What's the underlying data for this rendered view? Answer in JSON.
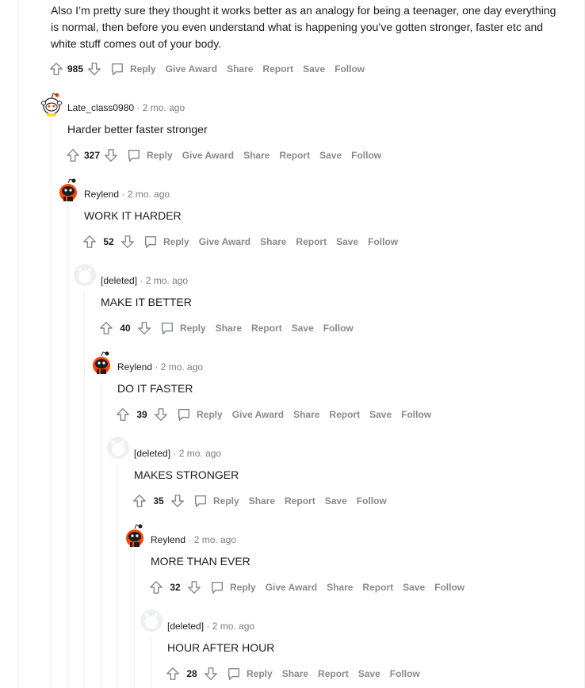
{
  "intro": {
    "text": "Also I’m pretty sure they thought it works better as an analogy for being a teenager, one day everything is normal, then before you even understand what is happening you’ve gotten stronger, faster etc and white stuff comes out of your body.",
    "score": "985",
    "reply": "Reply",
    "award": "Give Award",
    "share": "Share",
    "report": "Report",
    "save": "Save",
    "follow": "Follow"
  },
  "comments": [
    {
      "author": "Late_class0980",
      "time": "· 2 mo. ago",
      "body": "Harder better faster stronger",
      "score": "327",
      "reply": "Reply",
      "award": "Give Award",
      "share": "Share",
      "report": "Report",
      "save": "Save",
      "follow": "Follow",
      "avatar": "snoo-white"
    },
    {
      "author": "Reylend",
      "time": "· 2 mo. ago",
      "body": "WORK IT HARDER",
      "score": "52",
      "reply": "Reply",
      "award": "Give Award",
      "share": "Share",
      "report": "Report",
      "save": "Save",
      "follow": "Follow",
      "avatar": "snoo-orange"
    },
    {
      "author": "[deleted]",
      "time": "· 2 mo. ago",
      "body": "MAKE IT BETTER",
      "score": "40",
      "reply": "Reply",
      "share": "Share",
      "report": "Report",
      "save": "Save",
      "follow": "Follow",
      "avatar": "deleted"
    },
    {
      "author": "Reylend",
      "time": "· 2 mo. ago",
      "body": "DO IT FASTER",
      "score": "39",
      "reply": "Reply",
      "award": "Give Award",
      "share": "Share",
      "report": "Report",
      "save": "Save",
      "follow": "Follow",
      "avatar": "snoo-orange"
    },
    {
      "author": "[deleted]",
      "time": "· 2 mo. ago",
      "body": "MAKES STRONGER",
      "score": "35",
      "reply": "Reply",
      "share": "Share",
      "report": "Report",
      "save": "Save",
      "follow": "Follow",
      "avatar": "deleted"
    },
    {
      "author": "Reylend",
      "time": "· 2 mo. ago",
      "body": "MORE THAN EVER",
      "score": "32",
      "reply": "Reply",
      "award": "Give Award",
      "share": "Share",
      "report": "Report",
      "save": "Save",
      "follow": "Follow",
      "avatar": "snoo-orange"
    },
    {
      "author": "[deleted]",
      "time": "· 2 mo. ago",
      "body": "HOUR AFTER HOUR",
      "score": "28",
      "reply": "Reply",
      "share": "Share",
      "report": "Report",
      "save": "Save",
      "follow": "Follow",
      "avatar": "deleted"
    }
  ],
  "colors": {
    "upvote": "#878a8c",
    "text": "#1c1c1c",
    "meta": "#787c7e",
    "rail": "#edeff1",
    "snoo_orange": "#ff4500"
  }
}
